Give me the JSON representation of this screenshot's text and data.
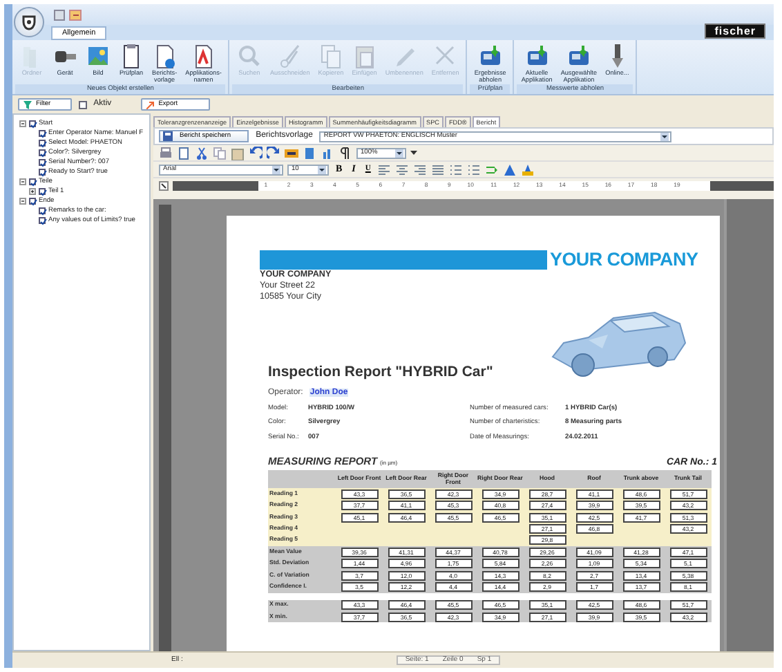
{
  "ribbon": {
    "tabs": [
      {
        "label": "Allgemein",
        "selected": true
      }
    ],
    "logo": "fischer",
    "groups": [
      {
        "label": "Neues Objekt erstellen",
        "buttons": [
          {
            "label": "Ordner",
            "disabled": true
          },
          {
            "label": "Gerät",
            "disabled": false
          },
          {
            "label": "Bild",
            "disabled": false
          },
          {
            "label": "Prüfplan",
            "disabled": false
          },
          {
            "label": "Berichts-\nvorlage",
            "disabled": false
          },
          {
            "label": "Applikations-\nnamen",
            "disabled": false
          }
        ]
      },
      {
        "label": "Bearbeiten",
        "buttons": [
          {
            "label": "Suchen",
            "disabled": true
          },
          {
            "label": "Ausschneiden",
            "disabled": true
          },
          {
            "label": "Kopieren",
            "disabled": true
          },
          {
            "label": "Einfügen",
            "disabled": true
          },
          {
            "label": "Umbenennen",
            "disabled": true
          },
          {
            "label": "Entfernen",
            "disabled": true
          }
        ]
      },
      {
        "label": "Prüfplan",
        "buttons": [
          {
            "label": "Ergebnisse\nabholen",
            "disabled": false
          }
        ]
      },
      {
        "label": "Messwerte abholen",
        "buttons": [
          {
            "label": "Aktuelle\nApplikation",
            "disabled": false
          },
          {
            "label": "Ausgewählte\nApplikation",
            "disabled": false
          },
          {
            "label": "Online...",
            "disabled": false
          }
        ]
      }
    ]
  },
  "filter_bar": {
    "filter_button": "Filter",
    "active_checkbox": {
      "label": "Aktiv",
      "checked": false
    },
    "export_button": "Export"
  },
  "tree": [
    {
      "label": "Start",
      "checked": true,
      "expanded": true,
      "children": [
        {
          "label": "Enter Operator Name: Manuel F",
          "checked": true
        },
        {
          "label": "Select Model: PHAETON",
          "checked": true
        },
        {
          "label": "Color?: Silvergrey",
          "checked": true
        },
        {
          "label": "Serial Number?: 007",
          "checked": true
        },
        {
          "label": "Ready to Start? true",
          "checked": true
        }
      ]
    },
    {
      "label": "Teile",
      "checked": true,
      "expanded": true,
      "children": [
        {
          "label": "Teil 1",
          "checked": true,
          "expanded": false
        }
      ]
    },
    {
      "label": "Ende",
      "checked": true,
      "expanded": true,
      "children": [
        {
          "label": "Remarks to the car:",
          "checked": true
        },
        {
          "label": "Any values out of Limits? true",
          "checked": true
        }
      ]
    }
  ],
  "view_tabs": [
    {
      "label": "Toleranzgrenzenanzeige",
      "selected": false
    },
    {
      "label": "Einzelgebnisse",
      "selected": false
    },
    {
      "label": "Histogramm",
      "selected": false
    },
    {
      "label": "Summenhäufigkeitsdiagramm",
      "selected": false
    },
    {
      "label": "SPC",
      "selected": false
    },
    {
      "label": "FDD®",
      "selected": false
    },
    {
      "label": "Bericht",
      "selected": true
    }
  ],
  "report_bar": {
    "save_button": "Bericht speichern",
    "template_label": "Berichtsvorlage",
    "template_value": "REPORT VW PHAETON: ENGLISCH Muster"
  },
  "editor_toolbar": {
    "zoom": "100%",
    "font": "Arial",
    "size": "10",
    "format_buttons": [
      "B",
      "I",
      "U"
    ]
  },
  "ruler": [
    "1",
    "2",
    "3",
    "4",
    "5",
    "6",
    "7",
    "8",
    "9",
    "10",
    "11",
    "12",
    "13",
    "14",
    "15",
    "16",
    "17",
    "18",
    "19"
  ],
  "document": {
    "banner": "YOUR COMPANY",
    "address": [
      "YOUR COMPANY",
      "Your Street 22",
      "10585 Your City"
    ],
    "title": "Inspection Report \"HYBRID Car\"",
    "operator_label": "Operator:",
    "operator": "John Doe",
    "info_left": [
      {
        "label": "Model:",
        "value": "HYBRID 100/W"
      },
      {
        "label": "Color:",
        "value": "Silvergrey"
      },
      {
        "label": "Serial No.:",
        "value": "007"
      }
    ],
    "info_right": [
      {
        "label": "Number of measured cars:",
        "value": "1 HYBRID Car(s)"
      },
      {
        "label": "Number of charteristics:",
        "value": "8 Measuring parts"
      },
      {
        "label": "Date of Measurings:",
        "value": "24.02.2011"
      }
    ],
    "report_heading": "MEASURING REPORT",
    "report_unit": "(in µm)",
    "car_no": "CAR No.: 1",
    "table": {
      "columns": [
        {
          "label": "Left Door Front",
          "readings": [
            "43,3",
            "37,7",
            "45,1"
          ]
        },
        {
          "label": "Left Door Rear",
          "readings": [
            "36,5",
            "41,1",
            "46,4"
          ]
        },
        {
          "label": "Right Door Front",
          "readings": [
            "42,3",
            "45,3",
            "45,5"
          ]
        },
        {
          "label": "Right Door Rear",
          "readings": [
            "34,9",
            "40,8",
            "46,5"
          ]
        },
        {
          "label": "Hood",
          "readings": [
            "28,7",
            "27,4",
            "35,1",
            "27,1",
            "29,8"
          ]
        },
        {
          "label": "Roof",
          "readings": [
            "41,1",
            "39,9",
            "42,5",
            "46,8"
          ]
        },
        {
          "label": "Trunk above",
          "readings": [
            "48,6",
            "39,5",
            "41,7"
          ]
        },
        {
          "label": "Trunk Tail",
          "readings": [
            "51,7",
            "43,2",
            "51,3",
            "43,2"
          ]
        }
      ],
      "reading_labels": [
        "Reading 1",
        "Reading 2",
        "Reading 3",
        "Reading 4",
        "Reading 5"
      ],
      "sections": [
        {
          "kind": "stats",
          "rows": [
            {
              "label": "Mean Value",
              "values": [
                "39,36",
                "41,31",
                "44,37",
                "40,78",
                "29,26",
                "41,09",
                "41,28",
                "47,1"
              ]
            },
            {
              "label": "Std. Deviation",
              "values": [
                "1,44",
                "4,96",
                "1,75",
                "5,84",
                "2,26",
                "1,09",
                "5,34",
                "5,1"
              ]
            },
            {
              "label": "C. of Variation",
              "values": [
                "3,7",
                "12,0",
                "4,0",
                "14,3",
                "8,2",
                "2,7",
                "13,4",
                "5,38"
              ]
            },
            {
              "label": "Confidence I.",
              "values": [
                "3,5",
                "12,2",
                "4,4",
                "14,4",
                "2,9",
                "1,7",
                "13,7",
                "8,1"
              ]
            }
          ]
        },
        {
          "kind": "limits",
          "rows": [
            {
              "label": "X max.",
              "values": [
                "43,3",
                "46,4",
                "45,5",
                "46,5",
                "35,1",
                "42,5",
                "48,6",
                "51,7"
              ]
            },
            {
              "label": "X min.",
              "values": [
                "37,7",
                "36,5",
                "42,3",
                "34,9",
                "27,1",
                "39,9",
                "39,5",
                "43,2"
              ]
            }
          ]
        }
      ]
    }
  },
  "status_bar": {
    "left": "Ell :",
    "page": "Seite: 1",
    "line": "Zeile 0",
    "column": "Sp 1"
  }
}
